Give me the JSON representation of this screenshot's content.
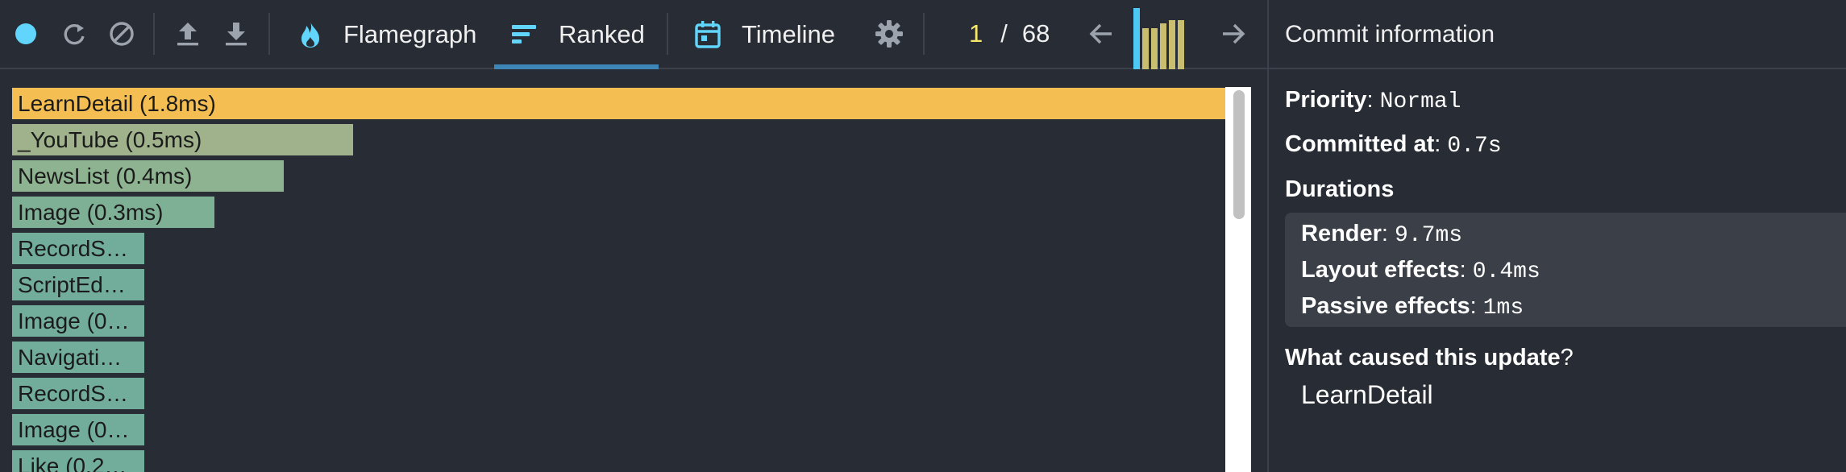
{
  "toolbar": {
    "tabs": [
      {
        "label": "Flamegraph",
        "icon": "flame-icon",
        "active": false
      },
      {
        "label": "Ranked",
        "icon": "ranked-icon",
        "active": true
      },
      {
        "label": "Timeline",
        "icon": "calendar-icon",
        "active": false
      }
    ],
    "icons": [
      "record-icon",
      "reload-icon",
      "clear-icon",
      "upload-icon",
      "download-icon",
      "gear-icon",
      "arrow-left-icon",
      "arrow-right-icon"
    ],
    "commit_counter": {
      "current": "1",
      "separator": "/",
      "total": "68"
    },
    "commit_bars": [
      {
        "level": 1.0,
        "selected": true
      },
      {
        "level": 0.78,
        "selected": false
      },
      {
        "level": 0.78,
        "selected": false
      },
      {
        "level": 0.86,
        "selected": false
      },
      {
        "level": 0.93,
        "selected": false
      },
      {
        "level": 0.93,
        "selected": false
      }
    ]
  },
  "colors": {
    "background": "#282c34",
    "accent": "#3f86b8",
    "selected_bar": "#f4be52",
    "counter_current": "#f7e76a",
    "commit_bar": "#c9bd6f",
    "commit_bar_selected": "#4ec8f4"
  },
  "ranked": {
    "items": [
      {
        "label": "LearnDetail (1.8ms)",
        "value": 1.0,
        "color": "#f4be52"
      },
      {
        "label": "_YouTube (0.5ms)",
        "value": 0.282,
        "color": "#9fb28c"
      },
      {
        "label": "NewsList (0.4ms)",
        "value": 0.225,
        "color": "#8eb391"
      },
      {
        "label": "Image (0.3ms)",
        "value": 0.168,
        "color": "#7eb096"
      },
      {
        "label": "RecordS…",
        "value": 0.11,
        "color": "#72ad9c"
      },
      {
        "label": "ScriptEd…",
        "value": 0.11,
        "color": "#72ad9c"
      },
      {
        "label": "Image (0…",
        "value": 0.11,
        "color": "#72ad9c"
      },
      {
        "label": "Navigati…",
        "value": 0.11,
        "color": "#72ad9c"
      },
      {
        "label": "RecordS…",
        "value": 0.11,
        "color": "#72ad9c"
      },
      {
        "label": "Image (0…",
        "value": 0.11,
        "color": "#72ad9c"
      },
      {
        "label": "Like (0.2…",
        "value": 0.11,
        "color": "#72ad9c"
      }
    ]
  },
  "panel": {
    "title": "Commit information",
    "priority_label": "Priority",
    "priority_value": "Normal",
    "committed_label": "Committed at",
    "committed_value": "0.7s",
    "durations_label": "Durations",
    "render_label": "Render",
    "render_value": "9.7ms",
    "layout_label": "Layout effects",
    "layout_value": "0.4ms",
    "passive_label": "Passive effects",
    "passive_value": "1ms",
    "cause_label": "What caused this update",
    "cause_qmark": "?",
    "cause_component": "LearnDetail",
    "colon": ":"
  }
}
